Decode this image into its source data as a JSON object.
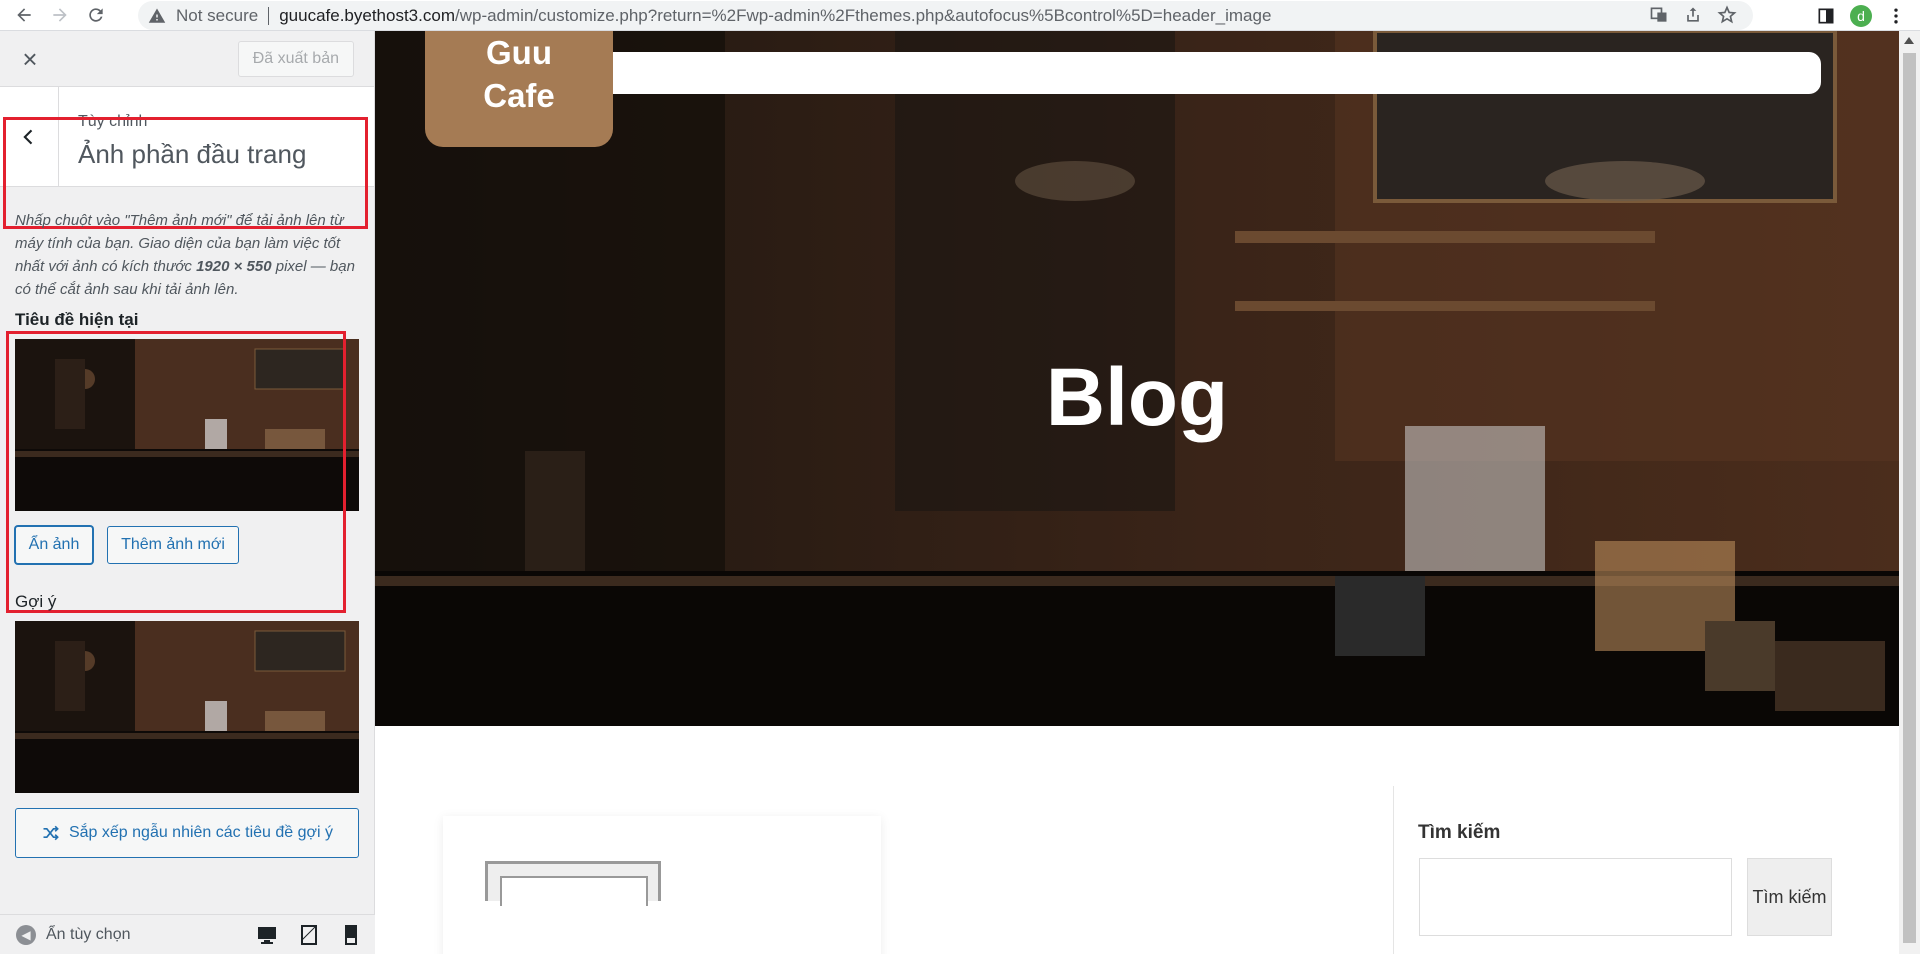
{
  "browser": {
    "security": "Not secure",
    "url_host": "guucafe.byethost3.com",
    "url_path": "/wp-admin/customize.php?return=%2Fwp-admin%2Fthemes.php&autofocus%5Bcontrol%5D=header_image",
    "profile_initial": "d"
  },
  "sidebar": {
    "close_label": "×",
    "published_label": "Đã xuất bản",
    "section_small": "Tùy chỉnh",
    "section_large": "Ảnh phần đầu trang",
    "description_1": "Nhấp chuột vào \"Thêm ảnh mới\" để tải ảnh lên từ máy tính của bạn. Giao diện của bạn làm việc tốt nhất với ảnh có kích thước ",
    "description_size": "1920 × 550",
    "description_2": " pixel — bạn có thể cắt ảnh sau khi tải ảnh lên.",
    "current_title": "Tiêu đề hiện tại",
    "hide_image_label": "Ẩn ảnh",
    "add_image_label": "Thêm ảnh mới",
    "suggestion_title": "Gợi ý",
    "shuffle_label": "Sắp xếp ngẫu nhiên các tiêu đề gợi ý",
    "footer_hide_label": "Ẩn tùy chọn"
  },
  "preview": {
    "logo_line1": "Guu",
    "logo_line2": "Cafe",
    "blog_title": "Blog",
    "search_title": "Tìm kiếm",
    "search_button": "Tìm kiếm"
  },
  "colors": {
    "accent": "#2271b1",
    "highlight_box": "#e3202f",
    "logo_bg": "#a57b54"
  }
}
